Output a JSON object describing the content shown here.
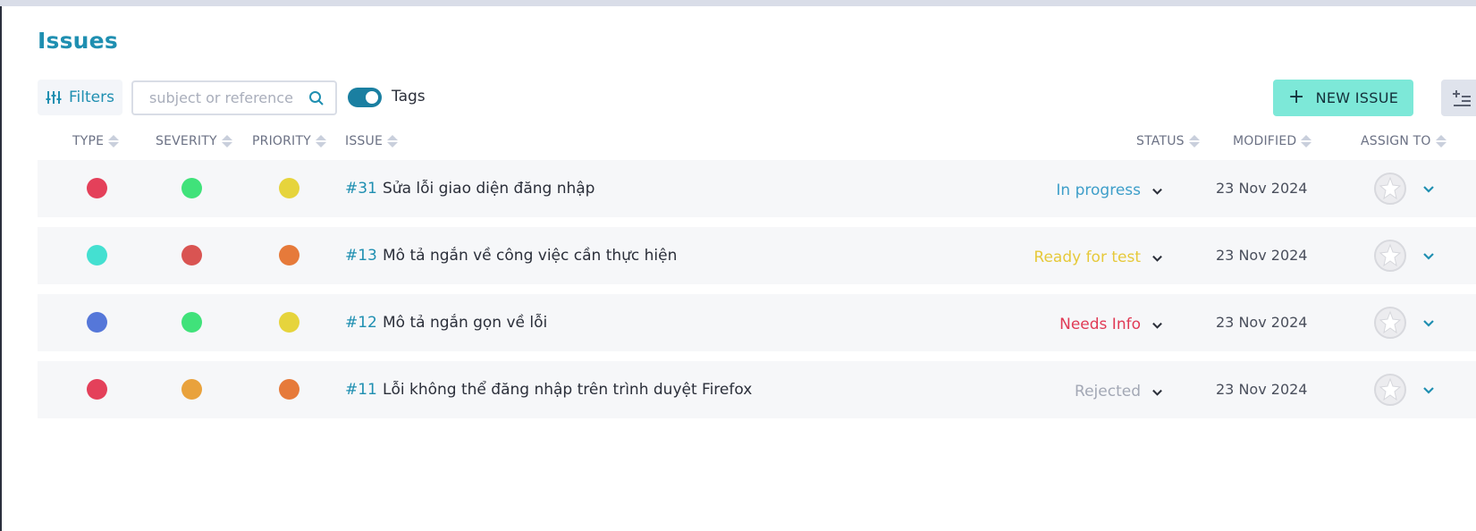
{
  "page": {
    "title": "Issues"
  },
  "toolbar": {
    "filters_label": "Filters",
    "search_placeholder": "subject or reference",
    "tags_label": "Tags",
    "tags_enabled": true,
    "new_issue_label": "NEW ISSUE"
  },
  "columns": {
    "type": "TYPE",
    "severity": "SEVERITY",
    "priority": "PRIORITY",
    "issue": "ISSUE",
    "status": "STATUS",
    "modified": "MODIFIED",
    "assign_to": "ASSIGN TO"
  },
  "rows": [
    {
      "ref": "#31",
      "subject": "Sửa lỗi giao diện đăng nhập",
      "type_color": "#e4405a",
      "severity_color": "#40e27a",
      "priority_color": "#e6d43c",
      "status": "In progress",
      "status_color": "#3d9ec9",
      "modified": "23 Nov 2024"
    },
    {
      "ref": "#13",
      "subject": "Mô tả ngắn về công việc cần thực hiện",
      "type_color": "#44e0d1",
      "severity_color": "#d95452",
      "priority_color": "#e67a3a",
      "status": "Ready for test",
      "status_color": "#e6c93a",
      "modified": "23 Nov 2024"
    },
    {
      "ref": "#12",
      "subject": "Mô tả ngắn gọn về lỗi",
      "type_color": "#5577d9",
      "severity_color": "#40e27a",
      "priority_color": "#e6d43c",
      "status": "Needs Info",
      "status_color": "#e03a55",
      "modified": "23 Nov 2024"
    },
    {
      "ref": "#11",
      "subject": "Lỗi không thể đăng nhập trên trình duyệt Firefox",
      "type_color": "#e4405a",
      "severity_color": "#e9a23c",
      "priority_color": "#e67a3a",
      "status": "Rejected",
      "status_color": "#a3a8b5",
      "modified": "23 Nov 2024"
    }
  ],
  "colors": {
    "accent": "#1f8fb1",
    "new_issue_bg": "#7de8d8",
    "row_bg": "#f6f7f9"
  },
  "icons": {
    "filters": "sliders-icon",
    "search": "search-icon",
    "new_issue": "plus-icon",
    "columns": "columns-icon",
    "status": "chevron-down-icon",
    "assign": "chevron-down-icon"
  }
}
